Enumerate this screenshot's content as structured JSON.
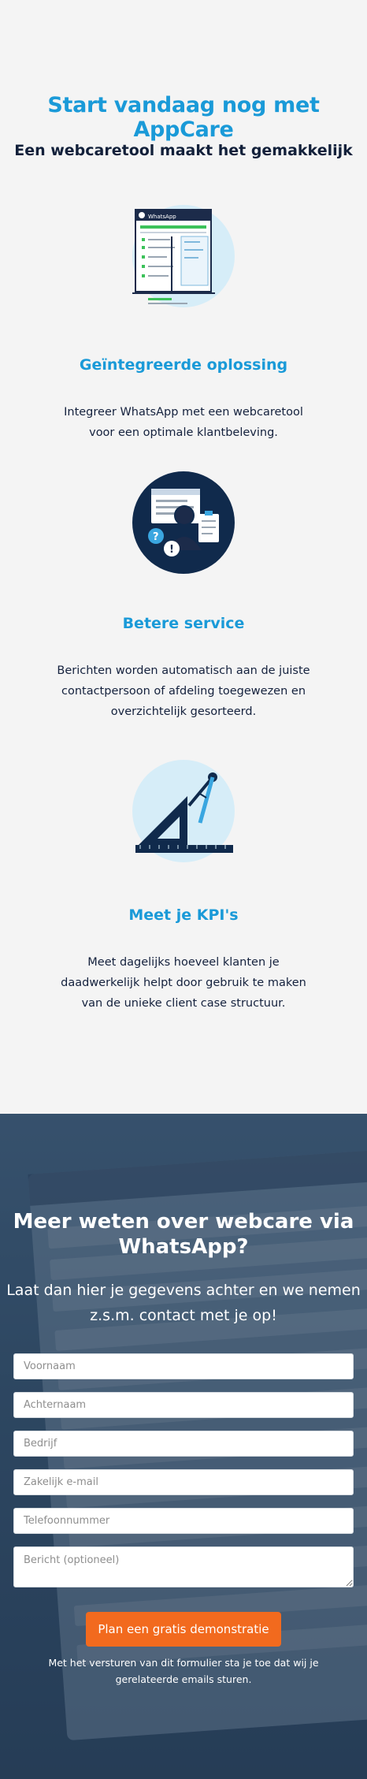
{
  "hero": {
    "title": "Start vandaag nog met AppCare",
    "subtitle": "Een webcaretool maakt het gemakkelijk"
  },
  "features": [
    {
      "icon": "whatsapp-webcare-illustration-icon",
      "illustration_label": "WhatsApp",
      "title": "Geïntegreerde oplossing",
      "text": "Integreer WhatsApp met een webcaretool voor een optimale klantbeleving."
    },
    {
      "icon": "customer-service-agent-icon",
      "title": "Betere service",
      "text": "Berichten worden automatisch aan de juiste contactpersoon of afdeling toegewezen en overzichtelijk gesorteerd."
    },
    {
      "icon": "ruler-compass-icon",
      "title": "Meet je KPI's",
      "text": "Meet dagelijks hoeveel klanten je daadwerkelijk helpt door gebruik te maken van de unieke client case structuur."
    }
  ],
  "form": {
    "title": "Meer weten over webcare via WhatsApp?",
    "subtitle": "Laat dan hier je gegevens achter en we nemen z.s.m. contact met je op!",
    "fields": {
      "voornaam": "Voornaam",
      "achternaam": "Achternaam",
      "bedrijf": "Bedrijf",
      "email": "Zakelijk e-mail",
      "telefoon": "Telefoonnummer",
      "bericht": "Bericht (optioneel)"
    },
    "submit_label": "Plan een gratis demonstratie",
    "disclaimer": "Met het versturen van dit formulier sta je toe dat wij je gerelateerde emails sturen."
  },
  "colors": {
    "accent_blue": "#1a9ad8",
    "navy": "#102a4c",
    "cta_orange": "#f26a1e",
    "whatsapp_green": "#3cc25a"
  }
}
